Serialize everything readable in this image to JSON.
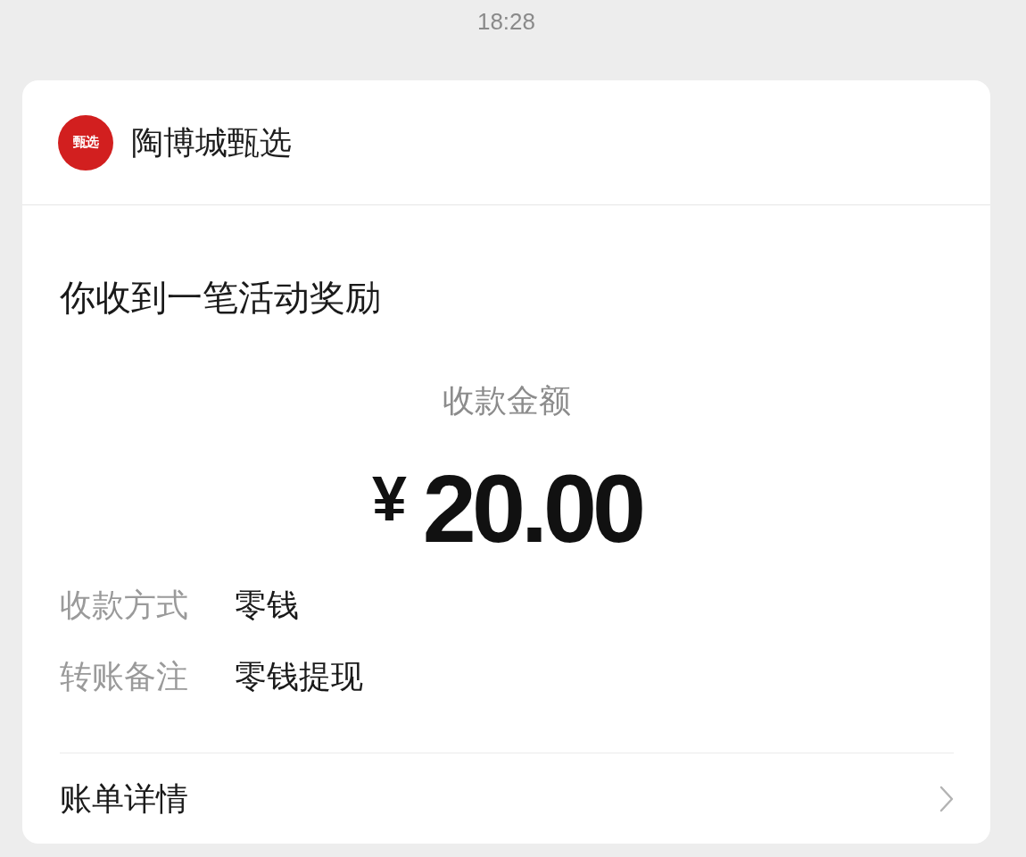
{
  "timestamp": "18:28",
  "card": {
    "merchant": {
      "name": "陶博城甄选",
      "logo_text": "甄选"
    },
    "title": "你收到一笔活动奖励",
    "amount": {
      "label": "收款金额",
      "currency": "¥",
      "value": "20.00"
    },
    "details": [
      {
        "label": "收款方式",
        "value": "零钱"
      },
      {
        "label": "转账备注",
        "value": "零钱提现"
      }
    ],
    "link": {
      "label": "账单详情"
    }
  }
}
